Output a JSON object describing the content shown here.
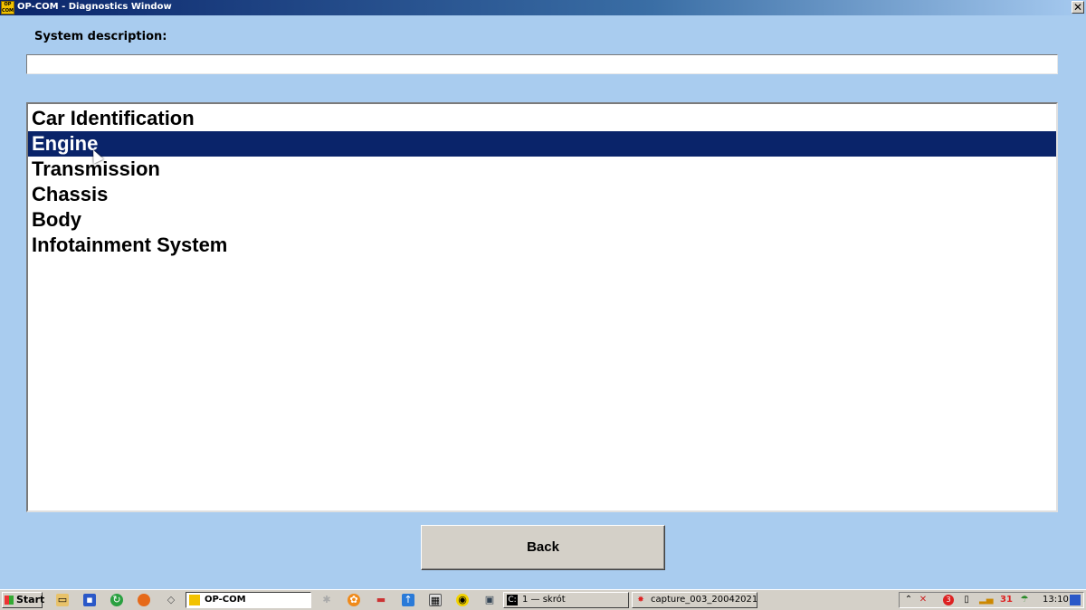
{
  "window": {
    "title": "OP-COM - Diagnostics Window",
    "app_icon_text": "OP COM",
    "close_glyph": "✕"
  },
  "system_description": {
    "label": "System description:",
    "value": ""
  },
  "systems": {
    "items": [
      {
        "label": "Car Identification",
        "selected": false
      },
      {
        "label": "Engine",
        "selected": true
      },
      {
        "label": "Transmission",
        "selected": false
      },
      {
        "label": "Chassis",
        "selected": false
      },
      {
        "label": "Body",
        "selected": false
      },
      {
        "label": "Infotainment System",
        "selected": false
      }
    ]
  },
  "buttons": {
    "back": "Back"
  },
  "taskbar": {
    "start_label": "Start",
    "tasks": [
      {
        "label": "OP-COM",
        "icon": "opcom-icon",
        "active": true
      },
      {
        "label": "1 — skrót",
        "icon": "cmd-icon",
        "active": false
      },
      {
        "label": "capture_003_20042021...",
        "icon": "capture-icon",
        "active": false
      }
    ],
    "tray_badge": "3",
    "tray_number": "31",
    "clock": "13:10"
  },
  "colors": {
    "background": "#a9ccef",
    "selection": "#0a246a",
    "titlebar": "#0a246a"
  }
}
